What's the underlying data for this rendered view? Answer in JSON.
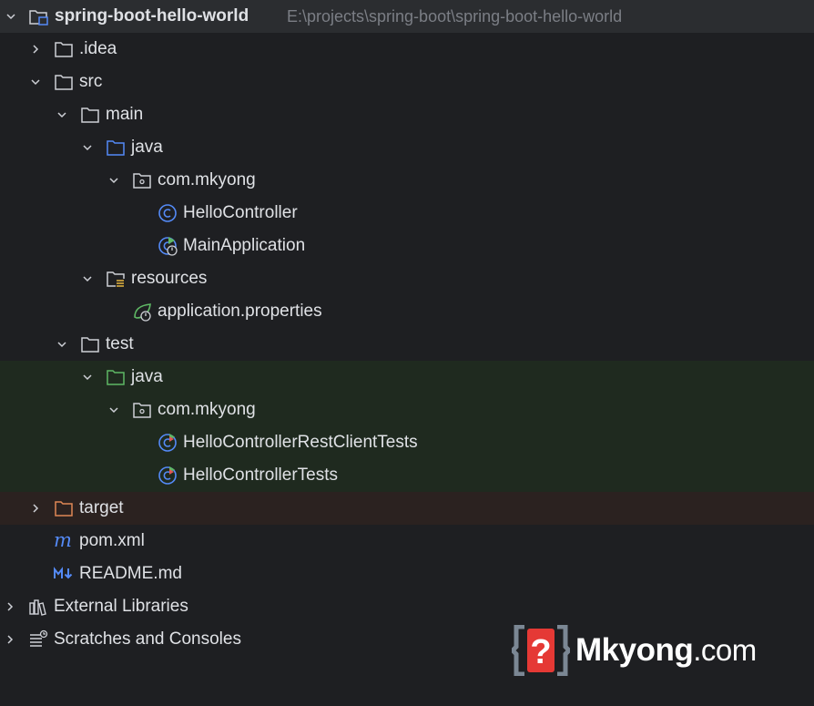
{
  "project": {
    "name": "spring-boot-hello-world",
    "path": "E:\\projects\\spring-boot\\spring-boot-hello-world"
  },
  "tree": {
    "idea": ".idea",
    "src": "src",
    "main": "main",
    "main_java": "java",
    "main_pkg": "com.mkyong",
    "hello_controller": "HelloController",
    "main_application": "MainApplication",
    "resources": "resources",
    "application_properties": "application.properties",
    "test": "test",
    "test_java": "java",
    "test_pkg": "com.mkyong",
    "rest_client_tests": "HelloControllerRestClientTests",
    "controller_tests": "HelloControllerTests",
    "target": "target",
    "pom": "pom.xml",
    "readme": "README.md",
    "external_libraries": "External Libraries",
    "scratches": "Scratches and Consoles"
  },
  "watermark": {
    "brand": "Mkyong",
    "tld": ".com"
  },
  "colors": {
    "background": "#1e1f22",
    "selected_row": "#2b2d30",
    "test_row": "#1f2a1f",
    "excluded_row": "#2b2220",
    "source_folder": "#548af7",
    "test_folder": "#5fb865",
    "excluded_folder": "#e08855",
    "class_icon": "#548af7"
  }
}
